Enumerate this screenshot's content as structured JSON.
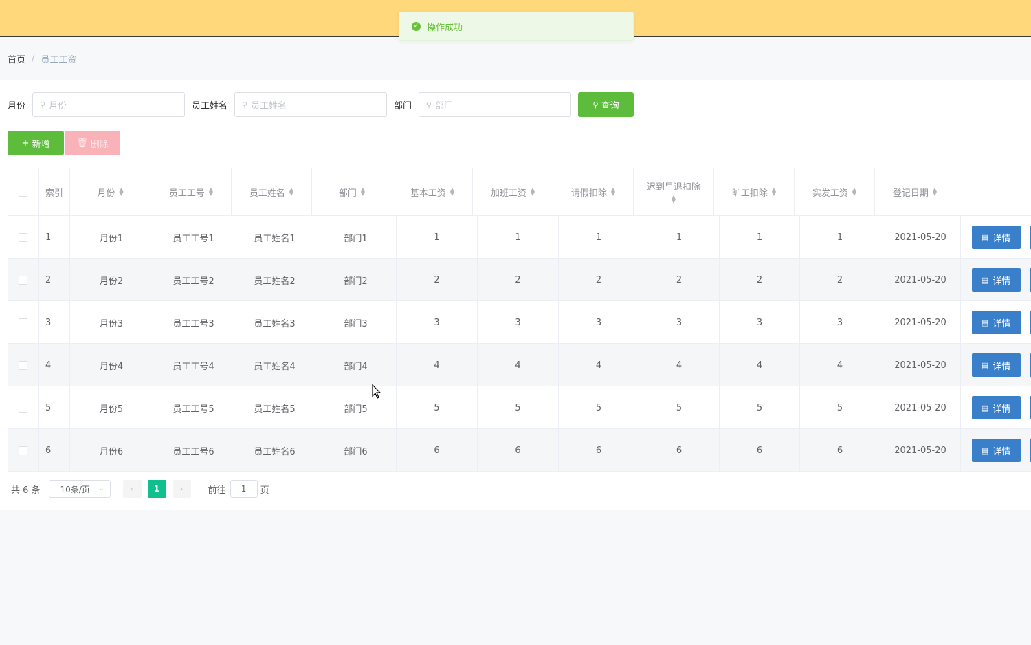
{
  "toast": {
    "message": "操作成功",
    "icon": "check-circle-icon"
  },
  "breadcrumb": {
    "home": "首页",
    "separator": "/",
    "current": "员工工资"
  },
  "search": {
    "month_label": "月份",
    "month_placeholder": "月份",
    "name_label": "员工姓名",
    "name_placeholder": "员工姓名",
    "dept_label": "部门",
    "dept_placeholder": "部门",
    "query_button": "查询"
  },
  "actions": {
    "add": "新增",
    "delete": "删除"
  },
  "table": {
    "columns": {
      "index": "索引",
      "month": "月份",
      "emp_no": "员工工号",
      "emp_name": "员工姓名",
      "dept": "部门",
      "base": "基本工资",
      "overtime": "加班工资",
      "leave": "请假扣除",
      "late_l1": "迟到早退扣除",
      "absent": "旷工扣除",
      "actual": "实发工资",
      "date": "登记日期"
    },
    "detail_label": "详情",
    "rows": [
      {
        "index": "1",
        "month": "月份1",
        "emp_no": "员工工号1",
        "emp_name": "员工姓名1",
        "dept": "部门1",
        "base": "1",
        "overtime": "1",
        "leave": "1",
        "late": "1",
        "absent": "1",
        "actual": "1",
        "date": "2021-05-20"
      },
      {
        "index": "2",
        "month": "月份2",
        "emp_no": "员工工号2",
        "emp_name": "员工姓名2",
        "dept": "部门2",
        "base": "2",
        "overtime": "2",
        "leave": "2",
        "late": "2",
        "absent": "2",
        "actual": "2",
        "date": "2021-05-20"
      },
      {
        "index": "3",
        "month": "月份3",
        "emp_no": "员工工号3",
        "emp_name": "员工姓名3",
        "dept": "部门3",
        "base": "3",
        "overtime": "3",
        "leave": "3",
        "late": "3",
        "absent": "3",
        "actual": "3",
        "date": "2021-05-20"
      },
      {
        "index": "4",
        "month": "月份4",
        "emp_no": "员工工号4",
        "emp_name": "员工姓名4",
        "dept": "部门4",
        "base": "4",
        "overtime": "4",
        "leave": "4",
        "late": "4",
        "absent": "4",
        "actual": "4",
        "date": "2021-05-20"
      },
      {
        "index": "5",
        "month": "月份5",
        "emp_no": "员工工号5",
        "emp_name": "员工姓名5",
        "dept": "部门5",
        "base": "5",
        "overtime": "5",
        "leave": "5",
        "late": "5",
        "absent": "5",
        "actual": "5",
        "date": "2021-05-20"
      },
      {
        "index": "6",
        "month": "月份6",
        "emp_no": "员工工号6",
        "emp_name": "员工姓名6",
        "dept": "部门6",
        "base": "6",
        "overtime": "6",
        "leave": "6",
        "late": "6",
        "absent": "6",
        "actual": "6",
        "date": "2021-05-20"
      }
    ]
  },
  "pagination": {
    "total_text": "共 6 条",
    "page_size": "10条/页",
    "current_page": "1",
    "goto_label": "前往",
    "goto_value": "1",
    "page_suffix": "页"
  },
  "colors": {
    "topbar": "#ffd87c",
    "primary_green": "#5dbc3b",
    "danger_light": "#f9b2b8",
    "detail_blue": "#3a7fca",
    "page_active": "#0fbf8d"
  }
}
